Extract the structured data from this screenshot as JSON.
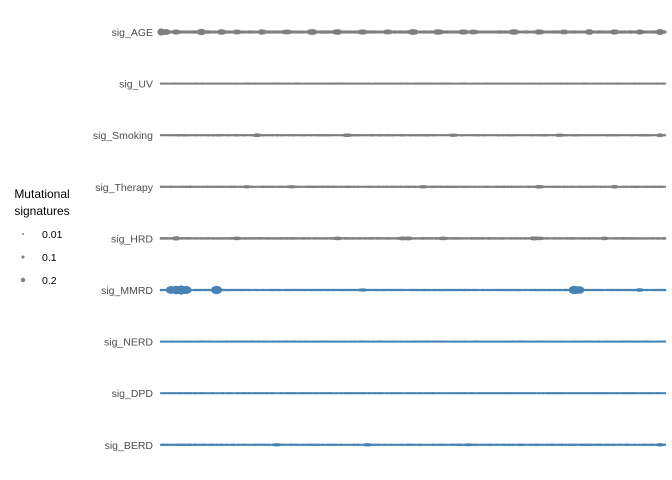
{
  "chart_data": {
    "type": "scatter",
    "title": "",
    "xlabel": "",
    "ylabel": "",
    "rows": [
      "sig_AGE",
      "sig_UV",
      "sig_Smoking",
      "sig_Therapy",
      "sig_HRD",
      "sig_MMRD",
      "sig_NERD",
      "sig_DPD",
      "sig_BERD"
    ],
    "colors": {
      "gray": "#7f7f7f",
      "blue": "#4682b4"
    },
    "row_colors": [
      "gray",
      "gray",
      "gray",
      "gray",
      "gray",
      "blue",
      "blue",
      "blue",
      "blue"
    ],
    "n_samples": 300,
    "legend": {
      "title_line1": "Mutational",
      "title_line2": "signatures",
      "items": [
        {
          "label": "0.01",
          "value": 0.01
        },
        {
          "label": "0.1",
          "value": 0.1
        },
        {
          "label": "0.2",
          "value": 0.2
        }
      ]
    },
    "series": [
      {
        "name": "sig_AGE",
        "base": 0.04,
        "peaks": [
          [
            0.0,
            0.16
          ],
          [
            0.01,
            0.12
          ],
          [
            0.03,
            0.1
          ],
          [
            0.08,
            0.14
          ],
          [
            0.12,
            0.12
          ],
          [
            0.15,
            0.1
          ],
          [
            0.2,
            0.11
          ],
          [
            0.25,
            0.1
          ],
          [
            0.3,
            0.13
          ],
          [
            0.35,
            0.12
          ],
          [
            0.4,
            0.11
          ],
          [
            0.45,
            0.1
          ],
          [
            0.5,
            0.13
          ],
          [
            0.55,
            0.12
          ],
          [
            0.6,
            0.11
          ],
          [
            0.62,
            0.1
          ],
          [
            0.7,
            0.12
          ],
          [
            0.75,
            0.11
          ],
          [
            0.8,
            0.1
          ],
          [
            0.85,
            0.12
          ],
          [
            0.9,
            0.11
          ],
          [
            0.95,
            0.1
          ],
          [
            0.99,
            0.12
          ]
        ]
      },
      {
        "name": "sig_UV",
        "base": 0.015,
        "peaks": []
      },
      {
        "name": "sig_Smoking",
        "base": 0.02,
        "peaks": [
          [
            0.19,
            0.06
          ],
          [
            0.37,
            0.06
          ],
          [
            0.58,
            0.05
          ],
          [
            0.79,
            0.05
          ],
          [
            0.99,
            0.06
          ]
        ]
      },
      {
        "name": "sig_Therapy",
        "base": 0.02,
        "peaks": [
          [
            0.17,
            0.05
          ],
          [
            0.26,
            0.05
          ],
          [
            0.52,
            0.05
          ],
          [
            0.75,
            0.06
          ],
          [
            0.9,
            0.06
          ]
        ]
      },
      {
        "name": "sig_HRD",
        "base": 0.025,
        "peaks": [
          [
            0.03,
            0.08
          ],
          [
            0.15,
            0.06
          ],
          [
            0.35,
            0.06
          ],
          [
            0.48,
            0.07
          ],
          [
            0.49,
            0.07
          ],
          [
            0.56,
            0.06
          ],
          [
            0.74,
            0.07
          ],
          [
            0.75,
            0.06
          ],
          [
            0.88,
            0.06
          ]
        ]
      },
      {
        "name": "sig_MMRD",
        "base": 0.02,
        "peaks": [
          [
            0.02,
            0.18
          ],
          [
            0.03,
            0.2
          ],
          [
            0.04,
            0.22
          ],
          [
            0.05,
            0.19
          ],
          [
            0.11,
            0.2
          ],
          [
            0.4,
            0.05
          ],
          [
            0.82,
            0.2
          ],
          [
            0.83,
            0.18
          ],
          [
            0.95,
            0.06
          ]
        ]
      },
      {
        "name": "sig_NERD",
        "base": 0.015,
        "peaks": []
      },
      {
        "name": "sig_DPD",
        "base": 0.015,
        "peaks": []
      },
      {
        "name": "sig_BERD",
        "base": 0.02,
        "peaks": [
          [
            0.23,
            0.05
          ],
          [
            0.41,
            0.05
          ],
          [
            0.61,
            0.04
          ],
          [
            0.99,
            0.05
          ]
        ]
      }
    ]
  }
}
